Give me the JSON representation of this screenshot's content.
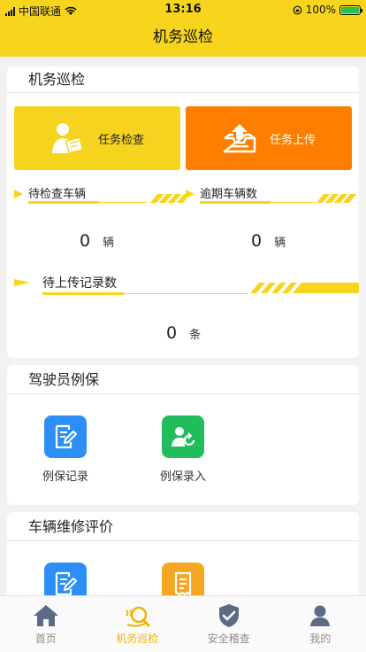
{
  "status_bar": {
    "carrier": "中国联通",
    "time": "13:16",
    "battery": "100%"
  },
  "nav": {
    "title": "机务巡检"
  },
  "inspection": {
    "title": "机务巡检",
    "task_check": "任务检查",
    "task_upload": "任务上传",
    "pending_vehicles": {
      "label": "待检查车辆",
      "value": "0",
      "unit": "辆"
    },
    "overdue_vehicles": {
      "label": "逾期车辆数",
      "value": "0",
      "unit": "辆"
    },
    "pending_upload": {
      "label": "待上传记录数",
      "value": "0",
      "unit": "条"
    }
  },
  "driver_maintenance": {
    "title": "驾驶员例保",
    "items": [
      {
        "label": "例保记录",
        "icon": "document-edit-icon",
        "color": "#2d8ff5"
      },
      {
        "label": "例保录入",
        "icon": "user-refresh-icon",
        "color": "#21bd5d"
      }
    ]
  },
  "repair_review": {
    "title": "车辆维修评价",
    "items": [
      {
        "icon": "document-edit-icon",
        "color": "#2d8ff5"
      },
      {
        "icon": "receipt-icon",
        "color": "#f5a623"
      }
    ]
  },
  "tabbar": {
    "items": [
      {
        "label": "首页",
        "icon": "home-icon"
      },
      {
        "label": "机务巡检",
        "icon": "inspection-icon",
        "active": true
      },
      {
        "label": "安全稽查",
        "icon": "shield-check-icon"
      },
      {
        "label": "我的",
        "icon": "user-icon"
      }
    ]
  },
  "colors": {
    "brand_yellow": "#f7d51d",
    "upload_orange": "#fe7f00",
    "active_tab": "#f0b500"
  }
}
